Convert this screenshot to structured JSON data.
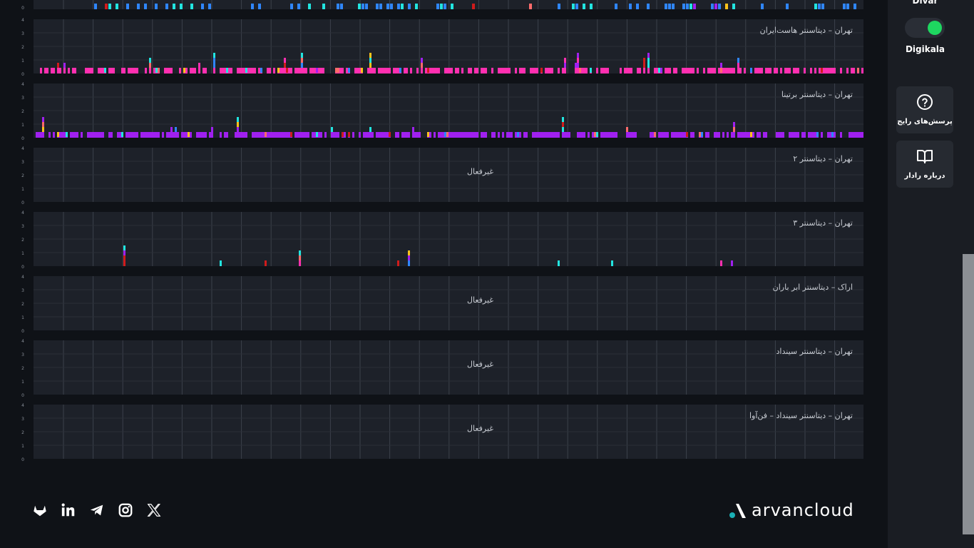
{
  "sidebar": {
    "top_service": "Divar",
    "service": "Digikala",
    "toggle_on": true,
    "faq_label": "پرسش‌های رایج",
    "about_label": "درباره رادار"
  },
  "panels": [
    {
      "title": "تهران – دیتاسنتر هاست‌ایران",
      "status": "",
      "bar_color": "#ff2fb0"
    },
    {
      "title": "تهران – دیتاسنتر برتینا",
      "status": "",
      "bar_color": "#a020f0"
    },
    {
      "title": "تهران – دیتاسنتر ۲",
      "status": "غیرفعال",
      "bar_color": ""
    },
    {
      "title": "تهران – دیتاسنتر ۳",
      "status": "",
      "bar_color": "#2f86ff"
    },
    {
      "title": "اراک – دیتاسنتر ابر باران",
      "status": "غیرفعال",
      "bar_color": ""
    },
    {
      "title": "تهران – دیتاسنتر سینداد",
      "status": "غیرفعال",
      "bar_color": ""
    },
    {
      "title": "تهران – دیتاسنتر سینداد – فن‌آوا",
      "status": "غیرفعال",
      "bar_color": ""
    }
  ],
  "y_ticks": [
    "4",
    "3",
    "2",
    "1",
    "0"
  ],
  "colors": {
    "magenta": "#ff2fb0",
    "purple": "#a020f0",
    "blue": "#2f86ff",
    "cyan": "#22e5e0",
    "red": "#d01b1b",
    "salmon": "#ff6b6b",
    "yellow": "#ffc21a",
    "accent_green": "#1ed760"
  },
  "footer": {
    "brand": "arvancloud",
    "social_icons": [
      "gitlab-icon",
      "linkedin-icon",
      "telegram-icon",
      "instagram-icon",
      "x-icon"
    ]
  }
}
